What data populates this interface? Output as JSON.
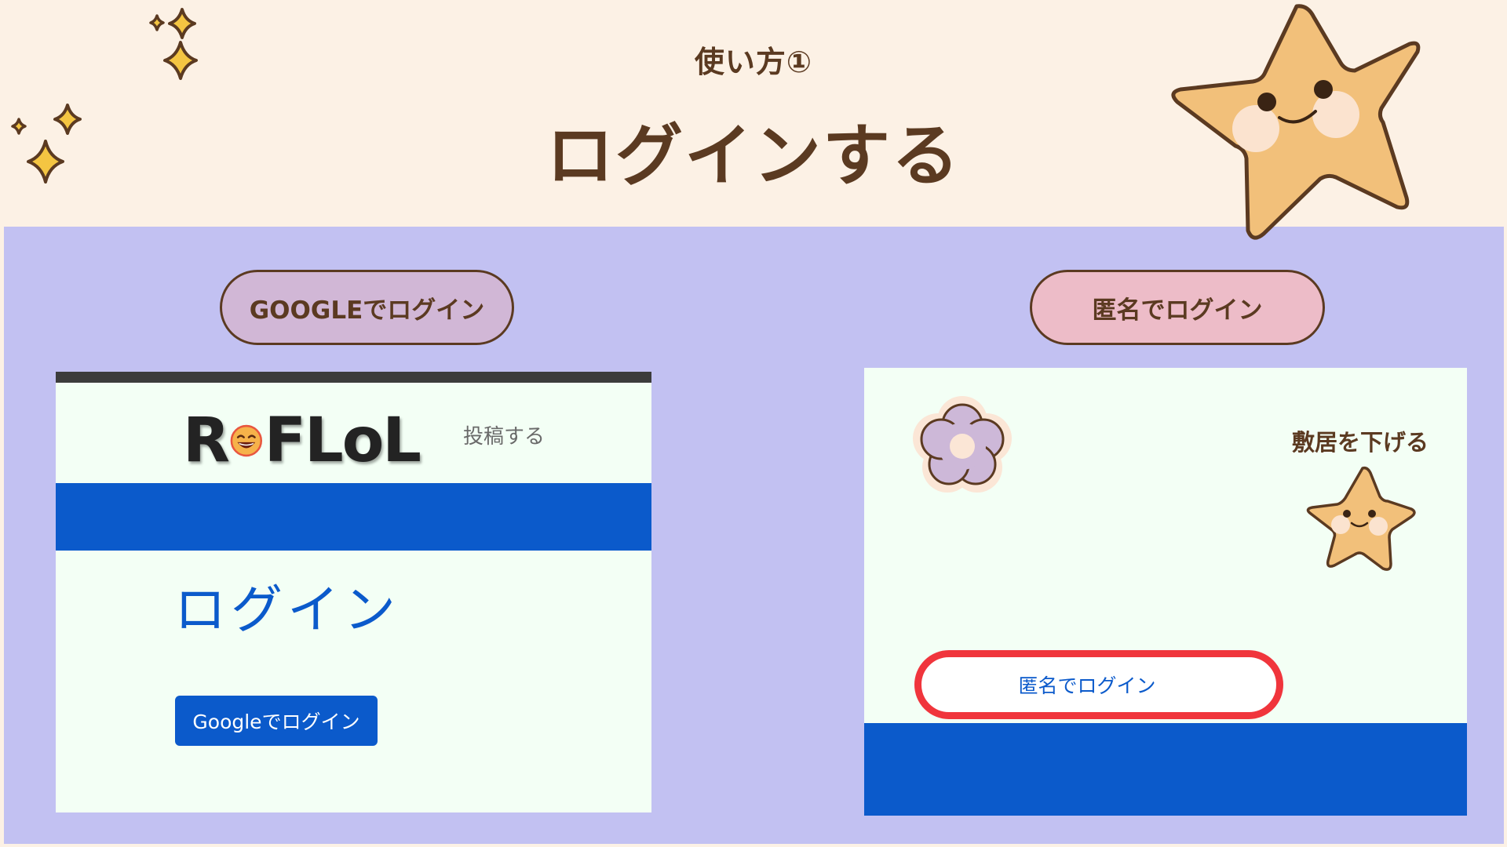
{
  "header": {
    "subtitle": "使い方①",
    "title": "ログインする"
  },
  "labels": {
    "google_pill": "GOOGLEでログイン",
    "anon_pill": "匿名でログイン"
  },
  "left_screenshot": {
    "logo_text_before": "R",
    "logo_text_after": "FLoL",
    "post_link": "投稿する",
    "heading": "ログイン",
    "google_button": "Googleでログイン"
  },
  "right_screenshot": {
    "threshold_text": "敷居を下げる",
    "anon_button": "匿名でログイン"
  },
  "icons": {
    "logo_emoji": "laughing-face-icon",
    "flower": "flower-icon",
    "star": "star-mascot-icon",
    "sparkles": "sparkle-icon"
  },
  "colors": {
    "background": "#fcf1e5",
    "panel": "#c2c1f2",
    "brown": "#5b3a21",
    "blue": "#0b5acb",
    "highlight_red": "#f0353c",
    "pill_google": "#d1b7d6",
    "pill_anon": "#edbcc8",
    "star_fill": "#f2c07a"
  }
}
